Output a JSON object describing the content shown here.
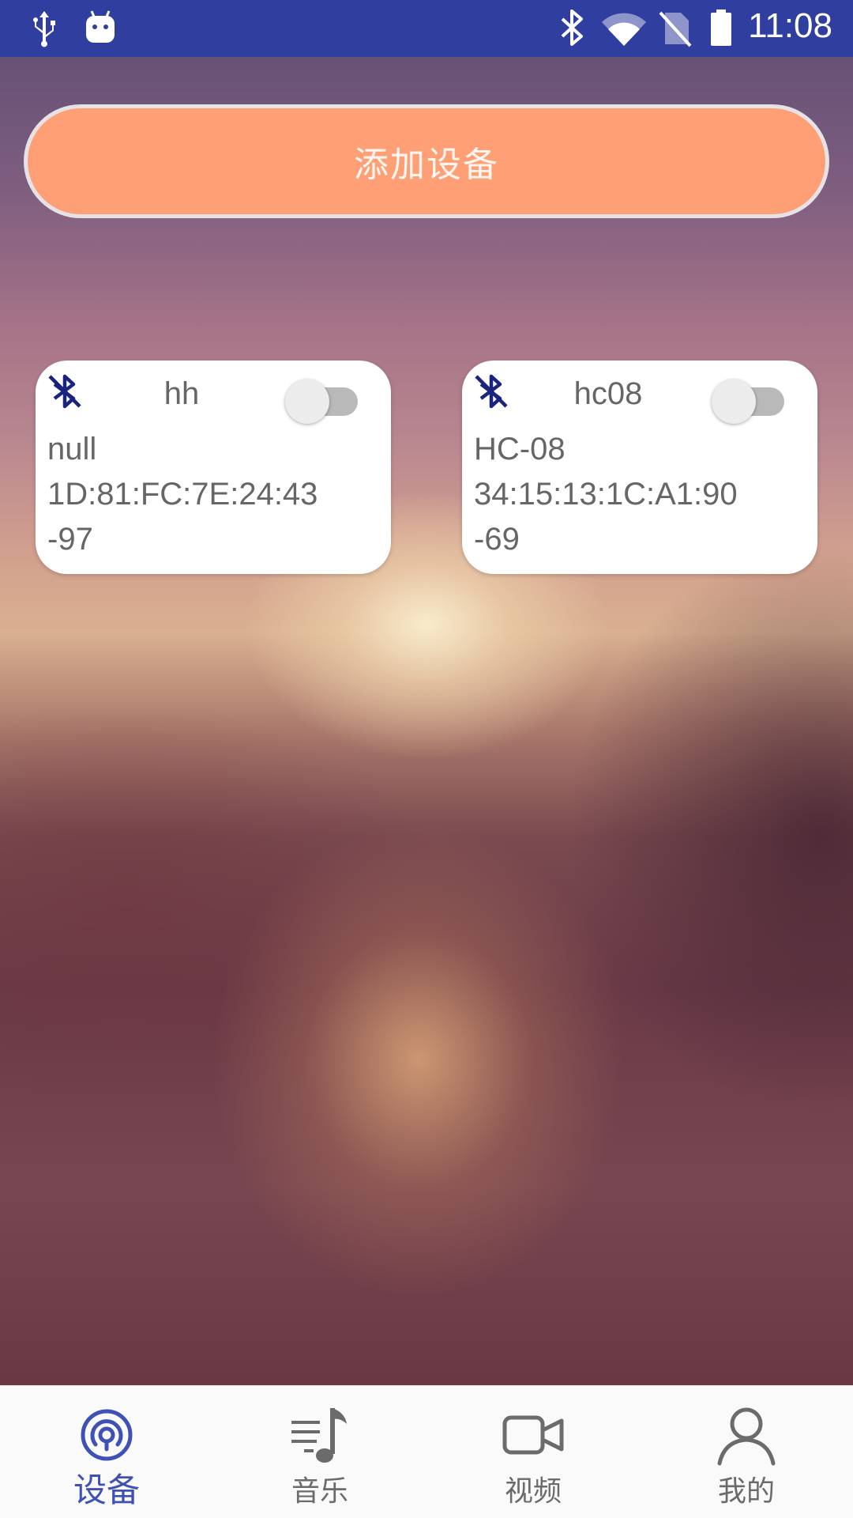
{
  "status_bar": {
    "time": "11:08",
    "icons": [
      "usb-icon",
      "android-debug-icon",
      "bluetooth-icon",
      "wifi-icon",
      "no-sim-icon",
      "battery-icon"
    ],
    "color": "#303f9f"
  },
  "add_button": {
    "label": "添加设备",
    "color": "#ff9f76"
  },
  "devices": [
    {
      "name": "hh",
      "line1": "null",
      "line2": "1D:81:FC:7E:24:43",
      "line3": "-97",
      "icon": "bluetooth-disabled-icon",
      "toggle_on": false
    },
    {
      "name": "hc08",
      "line1": "HC-08",
      "line2": "34:15:13:1C:A1:90",
      "line3": "-69",
      "icon": "bluetooth-disabled-icon",
      "toggle_on": false
    }
  ],
  "bottom_nav": {
    "active_color": "#3f51b5",
    "items": [
      {
        "label": "设备",
        "icon": "device-broadcast-icon",
        "active": true
      },
      {
        "label": "音乐",
        "icon": "music-icon",
        "active": false
      },
      {
        "label": "视频",
        "icon": "video-camera-icon",
        "active": false
      },
      {
        "label": "我的",
        "icon": "person-icon",
        "active": false
      }
    ]
  }
}
